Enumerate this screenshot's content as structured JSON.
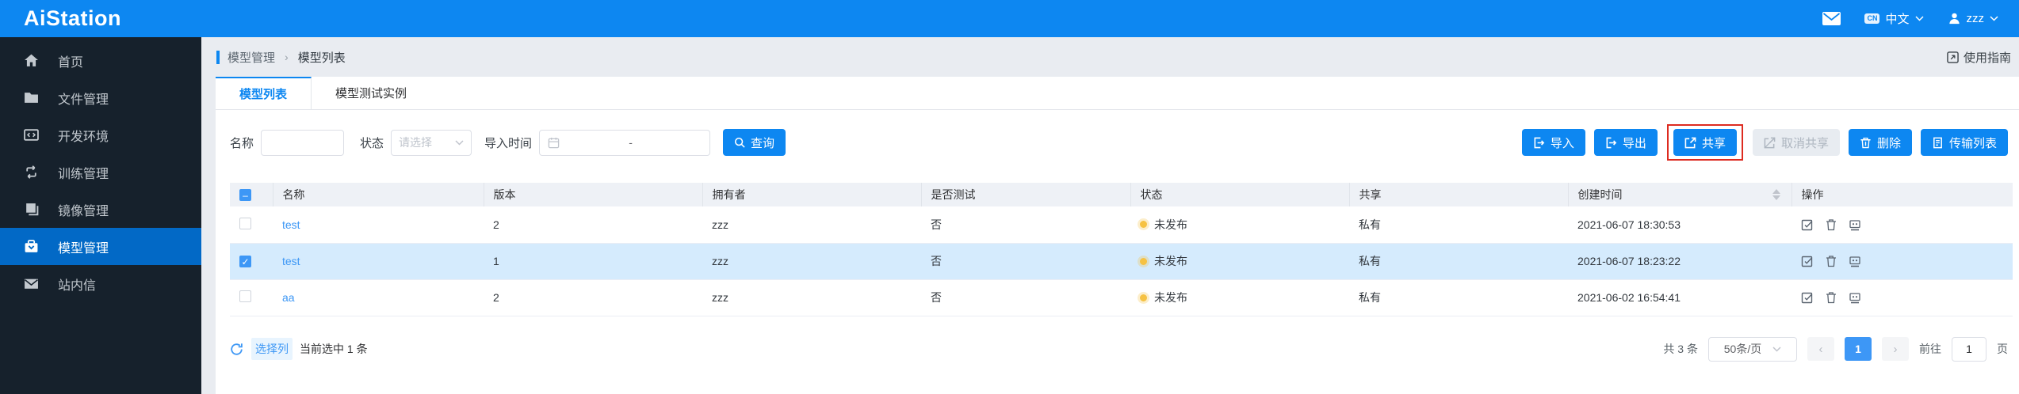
{
  "header": {
    "logo": "AiStation",
    "lang_badge": "CN",
    "language": "中文",
    "username": "zzz"
  },
  "sidebar": {
    "items": [
      {
        "label": "首页",
        "icon": "home-icon",
        "active": false
      },
      {
        "label": "文件管理",
        "icon": "folder-icon",
        "active": false
      },
      {
        "label": "开发环境",
        "icon": "code-icon",
        "active": false
      },
      {
        "label": "训练管理",
        "icon": "training-icon",
        "active": false
      },
      {
        "label": "镜像管理",
        "icon": "image-icon",
        "active": false
      },
      {
        "label": "模型管理",
        "icon": "model-icon",
        "active": true
      },
      {
        "label": "站内信",
        "icon": "mail-icon",
        "active": false
      }
    ]
  },
  "breadcrumb": {
    "first": "模型管理",
    "separator": "›",
    "second": "模型列表"
  },
  "guide_link": "使用指南",
  "tabs": [
    {
      "label": "模型列表",
      "active": true
    },
    {
      "label": "模型测试实例",
      "active": false
    }
  ],
  "filters": {
    "name_label": "名称",
    "status_label": "状态",
    "status_placeholder": "请选择",
    "import_time_label": "导入时间",
    "date_separator": "-",
    "search_button": "查询"
  },
  "toolbar": {
    "import_label": "导入",
    "export_label": "导出",
    "share_label": "共享",
    "unshare_label": "取消共享",
    "delete_label": "删除",
    "transfer_label": "传输列表"
  },
  "table": {
    "columns": [
      "名称",
      "版本",
      "拥有者",
      "是否测试",
      "状态",
      "共享",
      "创建时间",
      "操作"
    ],
    "rows": [
      {
        "name": "test",
        "version": "2",
        "owner": "zzz",
        "tested": "否",
        "status": "未发布",
        "share": "私有",
        "created": "2021-06-07 18:30:53",
        "checked": false
      },
      {
        "name": "test",
        "version": "1",
        "owner": "zzz",
        "tested": "否",
        "status": "未发布",
        "share": "私有",
        "created": "2021-06-07 18:23:22",
        "checked": true
      },
      {
        "name": "aa",
        "version": "2",
        "owner": "zzz",
        "tested": "否",
        "status": "未发布",
        "share": "私有",
        "created": "2021-06-02 16:54:41",
        "checked": false
      }
    ]
  },
  "footer": {
    "select_columns": "选择列",
    "selected_info": "当前选中 1 条",
    "total": "共 3 条",
    "page_size": "50条/页",
    "prev": "‹",
    "next": "›",
    "current_page": "1",
    "goto_prefix": "前往",
    "goto_value": "1",
    "goto_suffix": "页"
  },
  "colors": {
    "accent_blue": "#0d87f1",
    "sidebar_active_blue": "#0269c6",
    "selected_row_blue": "#d5ebfd",
    "status_yellow": "#f6c243",
    "link_blue": "#3d97f5",
    "annotation_red": "#dd2b20"
  }
}
